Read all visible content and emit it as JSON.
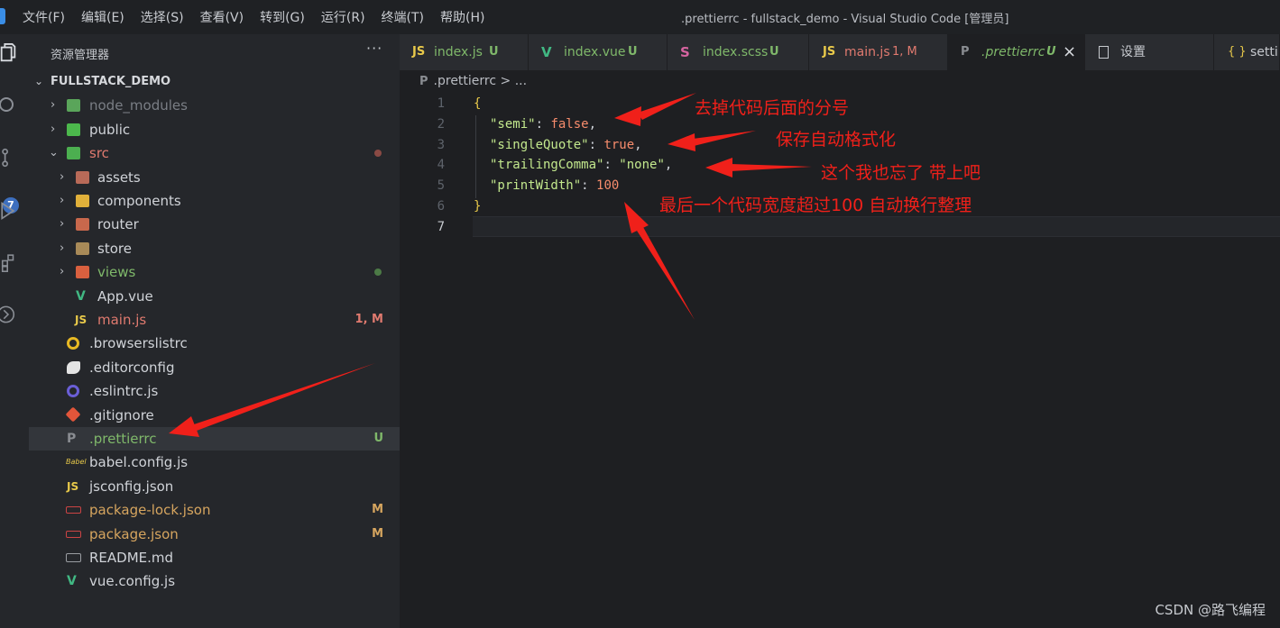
{
  "titlebar": {
    "menu": [
      "文件(F)",
      "编辑(E)",
      "选择(S)",
      "查看(V)",
      "转到(G)",
      "运行(R)",
      "终端(T)",
      "帮助(H)"
    ],
    "window_title": ".prettierrc - fullstack_demo - Visual Studio Code [管理员]"
  },
  "activitybar": {
    "badge": "7"
  },
  "sidebar": {
    "header": "资源管理器",
    "more": "···",
    "project": "FULLSTACK_DEMO",
    "items": [
      {
        "label": "node_modules",
        "status": ""
      },
      {
        "label": "public",
        "status": ""
      },
      {
        "label": "src",
        "status": ""
      },
      {
        "label": "assets",
        "status": ""
      },
      {
        "label": "components",
        "status": ""
      },
      {
        "label": "router",
        "status": ""
      },
      {
        "label": "store",
        "status": ""
      },
      {
        "label": "views",
        "status": ""
      },
      {
        "label": "App.vue",
        "status": ""
      },
      {
        "label": "main.js",
        "status": "1, M"
      },
      {
        "label": ".browserslistrc",
        "status": ""
      },
      {
        "label": ".editorconfig",
        "status": ""
      },
      {
        "label": ".eslintrc.js",
        "status": ""
      },
      {
        "label": ".gitignore",
        "status": ""
      },
      {
        "label": ".prettierrc",
        "status": "U"
      },
      {
        "label": "babel.config.js",
        "status": ""
      },
      {
        "label": "jsconfig.json",
        "status": ""
      },
      {
        "label": "package-lock.json",
        "status": "M"
      },
      {
        "label": "package.json",
        "status": "M"
      },
      {
        "label": "README.md",
        "status": ""
      },
      {
        "label": "vue.config.js",
        "status": ""
      }
    ]
  },
  "tabs": [
    {
      "icon": "JS",
      "label": "index.js",
      "status": "U"
    },
    {
      "icon": "V",
      "label": "index.vue",
      "status": "U"
    },
    {
      "icon": "S",
      "label": "index.scss",
      "status": "U"
    },
    {
      "icon": "JS",
      "label": "main.js",
      "status": "1, M"
    },
    {
      "icon": "P",
      "label": ".prettierrc",
      "status": "U",
      "close": "×"
    },
    {
      "icon": "doc",
      "label": "设置",
      "status": ""
    },
    {
      "icon": "{ }",
      "label": "setti",
      "status": ""
    }
  ],
  "breadcrumb": ".prettierrc > ...",
  "editor": {
    "line_numbers": [
      "1",
      "2",
      "3",
      "4",
      "5",
      "6",
      "7"
    ],
    "lines": {
      "l1_brace": "{",
      "l2_key": "\"semi\"",
      "l2_colon": ": ",
      "l2_val": "false",
      "l2_comma": ",",
      "l3_key": "\"singleQuote\"",
      "l3_colon": ": ",
      "l3_val": "true",
      "l3_comma": ",",
      "l4_key": "\"trailingComma\"",
      "l4_colon": ": ",
      "l4_val": "\"none\"",
      "l4_comma": ",",
      "l5_key": "\"printWidth\"",
      "l5_colon": ": ",
      "l5_val": "100",
      "l6_brace": "}"
    }
  },
  "annotations": {
    "a1": "去掉代码后面的分号",
    "a2": "保存自动格式化",
    "a3": "这个我也忘了 带上吧",
    "a4": "最后一个代码宽度超过100 自动换行整理"
  },
  "watermark": "CSDN @路飞编程",
  "colors": {
    "annotation": "#f0201a",
    "string": "#c3e88d",
    "keyword": "#f78c6c",
    "modified": "#d6a55f",
    "untracked": "#7fb86a"
  }
}
